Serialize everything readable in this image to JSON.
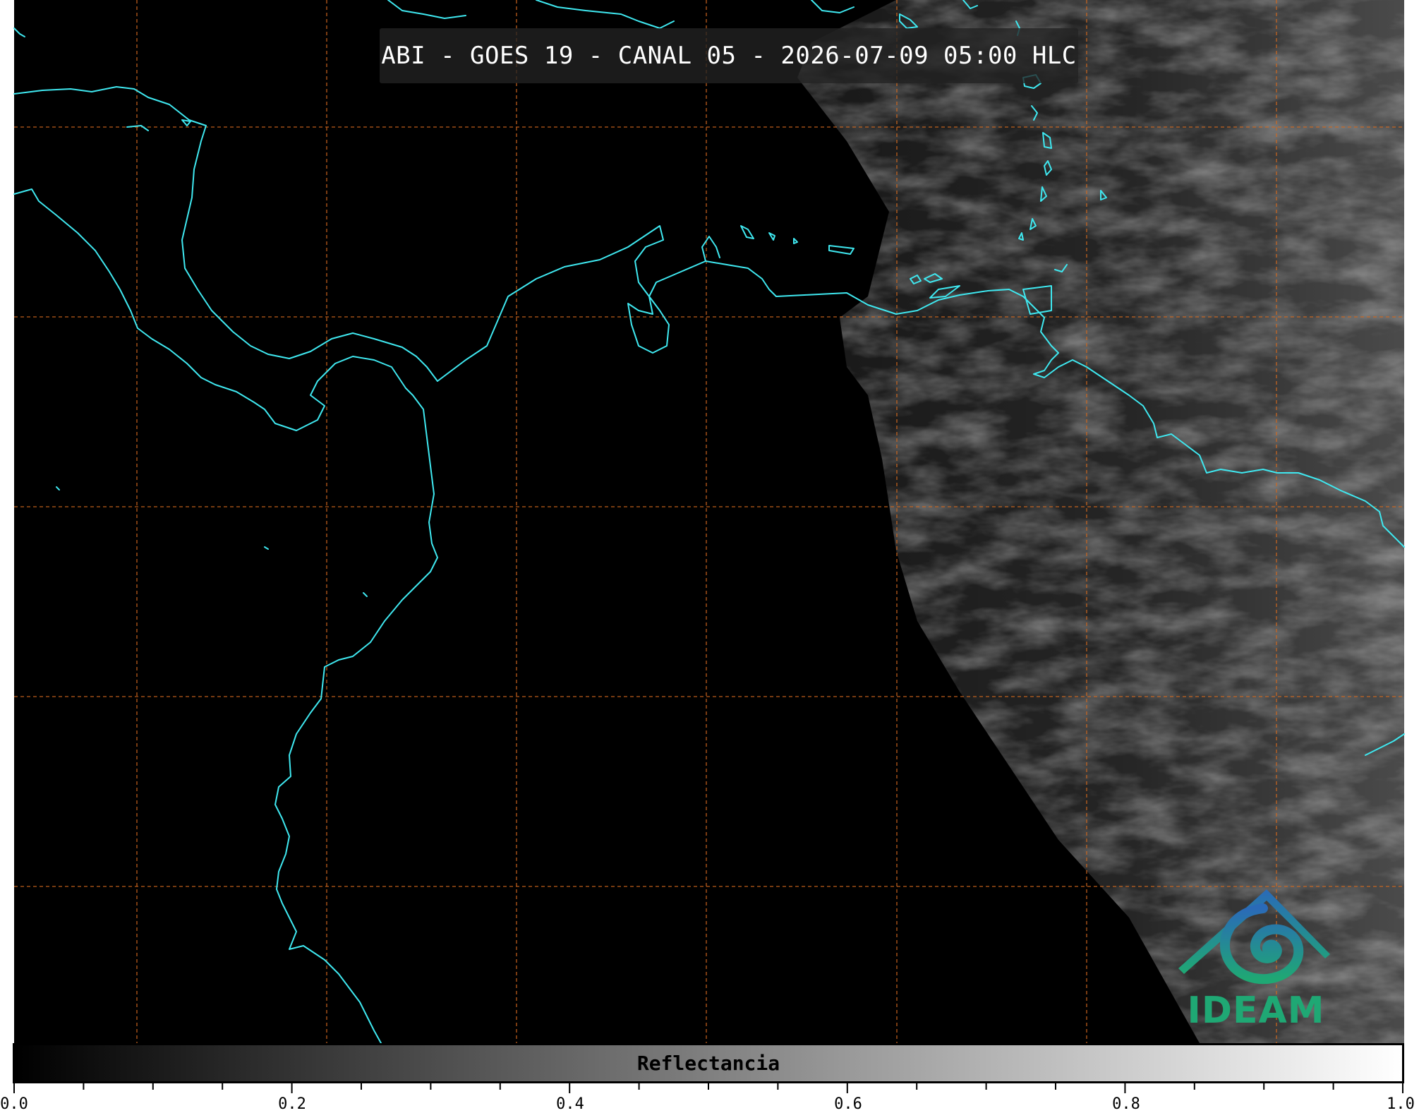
{
  "header": {
    "title": "ABI - GOES 19 - CANAL 05 - 2026-07-09 05:00 HLC"
  },
  "logo": {
    "text": "IDEAM",
    "colors": [
      "#2a6ab8",
      "#1fa874"
    ]
  },
  "colorbar": {
    "label": "Reflectancia",
    "range": [
      0.0,
      1.0
    ],
    "major_ticks": [
      "0.0",
      "0.2",
      "0.4",
      "0.6",
      "0.8",
      "1.0"
    ],
    "minor_tick_step": 0.05,
    "colormap": "grayscale"
  },
  "map": {
    "background": "#000000",
    "coastline_color": "#3fe8f0",
    "gridline_color": "#d2691e",
    "gridline_style": "dashed"
  }
}
